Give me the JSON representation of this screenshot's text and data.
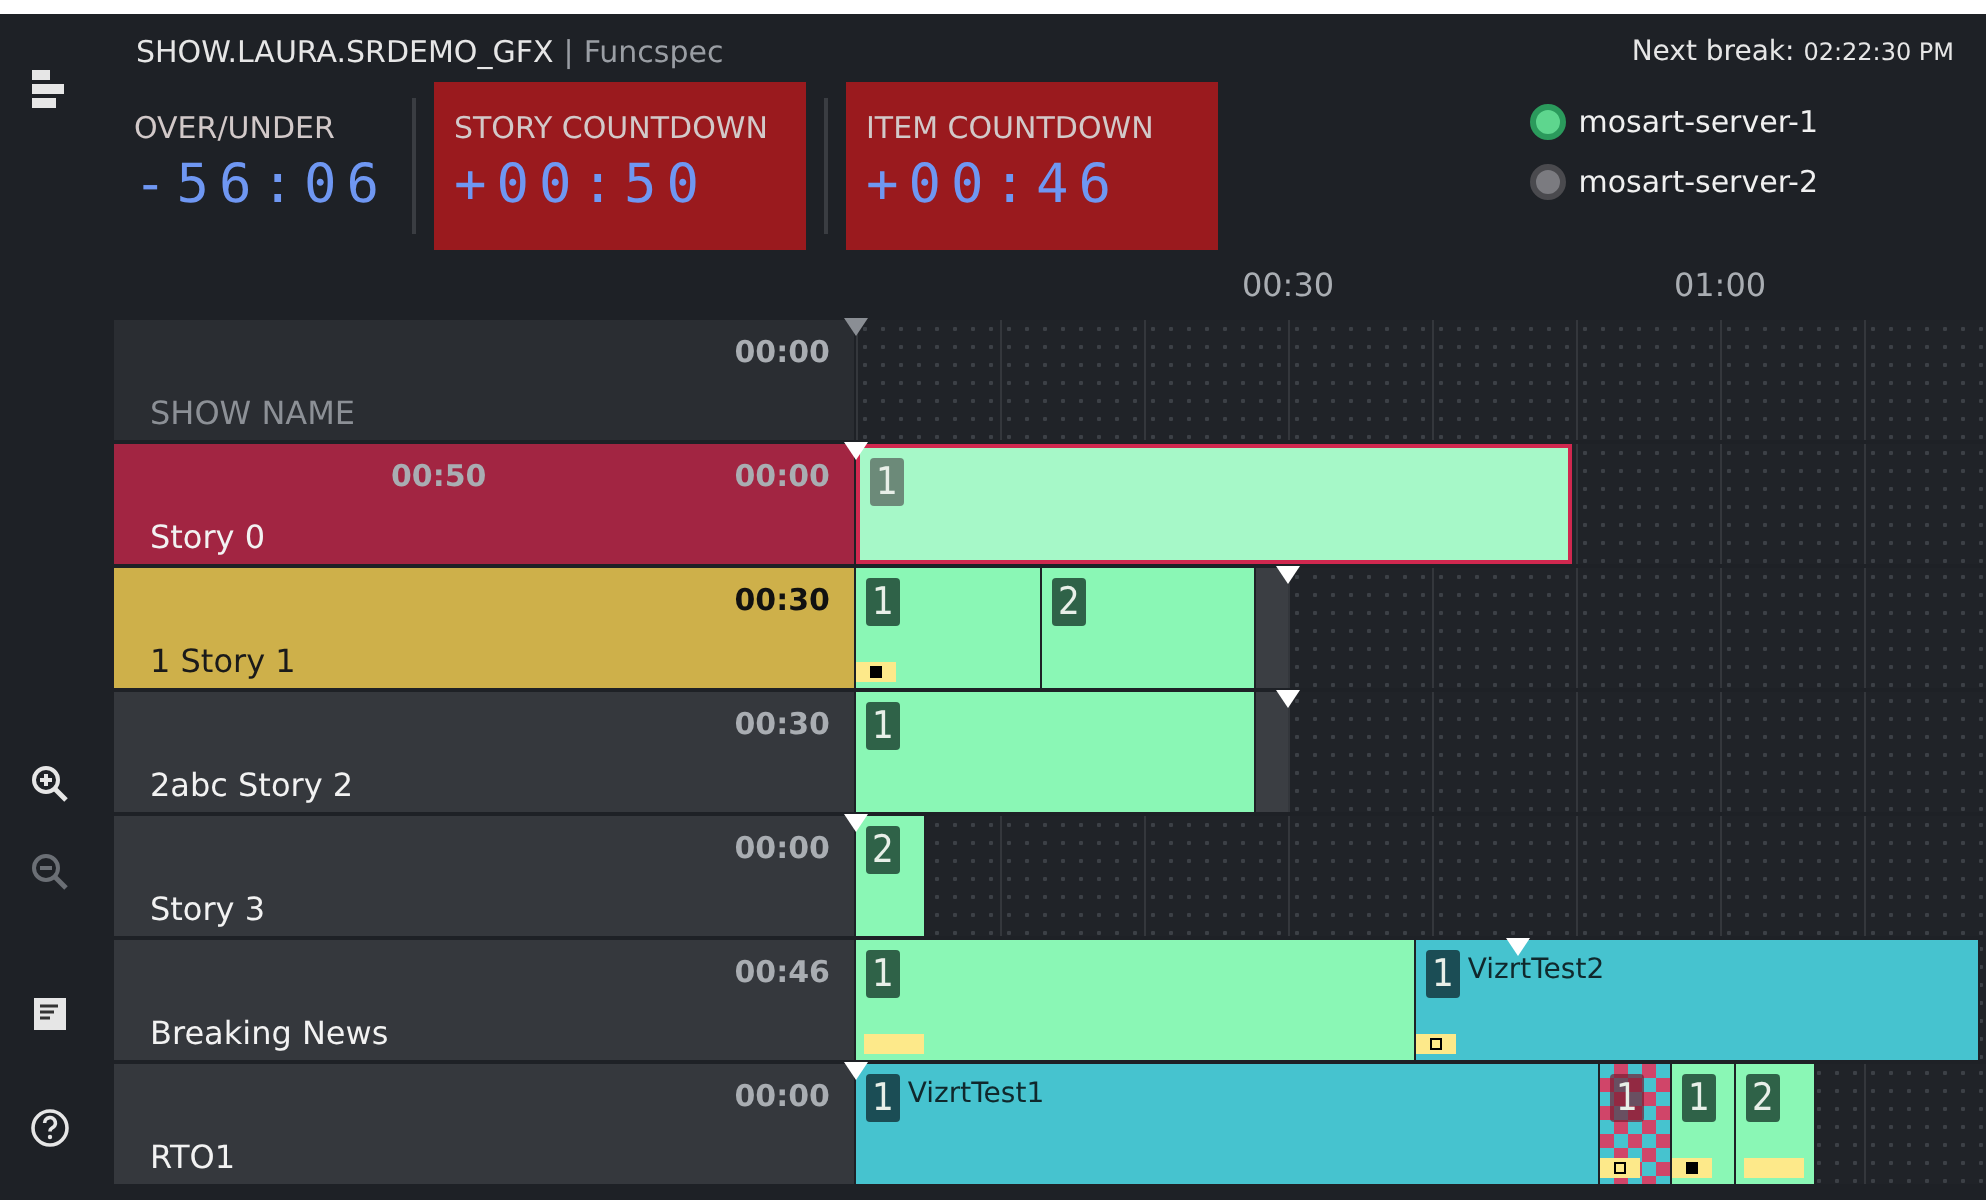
{
  "sidebar": {
    "tools": [
      {
        "kind": "zoomin",
        "disabled": false
      },
      {
        "kind": "zoomout",
        "disabled": true
      },
      {
        "kind": "notes",
        "disabled": false
      },
      {
        "kind": "help",
        "disabled": false
      }
    ]
  },
  "header": {
    "rundown": "SHOW.LAURA.SRDEMO_GFX",
    "separator": "|",
    "subtitle": "Funcspec",
    "counters": [
      {
        "label": "OVER/UNDER",
        "value": "-56:06",
        "alert": false
      },
      {
        "label": "STORY COUNTDOWN",
        "value": "+00:50",
        "alert": true
      },
      {
        "label": "ITEM COUNTDOWN",
        "value": "+00:46",
        "alert": true
      }
    ],
    "next_break_label": "Next break:",
    "next_break_time": "02:22:30 PM",
    "servers": [
      {
        "name": "mosart-server-1",
        "active": true
      },
      {
        "name": "mosart-server-2",
        "active": false
      }
    ]
  },
  "ruler": {
    "ticks": [
      "00:30",
      "01:00"
    ]
  },
  "stories": [
    {
      "name": "SHOW NAME",
      "time": "00:00",
      "kind": "header"
    },
    {
      "name": "Story 0",
      "time": "00:00",
      "countdown": "00:50",
      "kind": "onair",
      "items": [
        {
          "kind": "graphic",
          "number": "1"
        }
      ]
    },
    {
      "name": "1 Story 1",
      "time": "00:30",
      "kind": "next",
      "items": [
        {
          "kind": "graphic",
          "number": "1",
          "marker": {
            "kind": "filled"
          }
        },
        {
          "kind": "graphic",
          "number": "2"
        }
      ]
    },
    {
      "name": "2abc Story 2",
      "time": "00:30",
      "kind": "normal",
      "items": [
        {
          "kind": "graphic",
          "number": "1"
        }
      ]
    },
    {
      "name": "Story 3",
      "time": "00:00",
      "kind": "normal",
      "items": [
        {
          "kind": "graphic",
          "number": "2"
        }
      ]
    },
    {
      "name": "Breaking News",
      "time": "00:46",
      "kind": "normal",
      "items": [
        {
          "kind": "graphic",
          "number": "1",
          "marker": {
            "kind": "bar"
          }
        },
        {
          "kind": "video",
          "number": "1",
          "label": "VizrtTest2",
          "marker": {
            "kind": "hollow"
          }
        }
      ]
    },
    {
      "name": "RTO1",
      "time": "00:00",
      "kind": "normal",
      "items": [
        {
          "kind": "video",
          "number": "1",
          "label": "VizrtTest1"
        },
        {
          "kind": "missing",
          "number": "1",
          "marker": {
            "kind": "hollow"
          }
        },
        {
          "kind": "graphic",
          "number": "1",
          "marker": {
            "kind": "filled"
          }
        },
        {
          "kind": "graphic",
          "number": "2",
          "marker": {
            "kind": "bar"
          }
        }
      ]
    }
  ]
}
